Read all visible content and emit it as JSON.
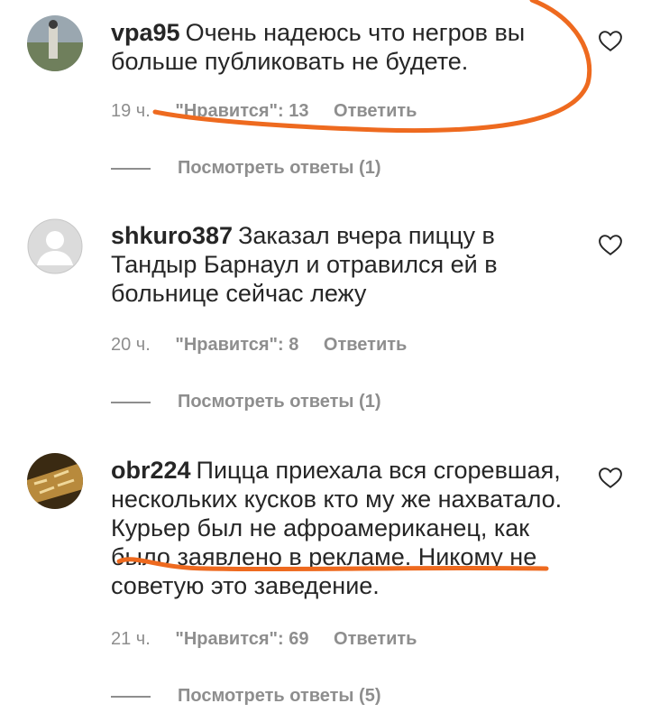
{
  "comments": [
    {
      "username": "vpa95",
      "text": "Очень надеюсь что негров вы больше публиковать не будете.",
      "time": "19 ч.",
      "likes": "\"Нравится\": 13",
      "reply": "Ответить",
      "view_replies": "Посмотреть ответы (1)"
    },
    {
      "username": "shkuro387",
      "text": "Заказал вчера пиццу в Тандыр Барнаул и отравился ей в больнице сейчас лежу",
      "time": "20 ч.",
      "likes": "\"Нравится\": 8",
      "reply": "Ответить",
      "view_replies": "Посмотреть ответы (1)"
    },
    {
      "username": "obr224",
      "text": "Пицца приехала вся сгоревшая, нескольких кусков кто му же нахватало. Курьер был не афроамериканец, как было заявлено в рекламе. Никому не советую это заведение.",
      "time": "21 ч.",
      "likes": "\"Нравится\": 69",
      "reply": "Ответить",
      "view_replies": "Посмотреть ответы (5)"
    }
  ],
  "icons": {
    "like": "heart-outline-icon",
    "default_avatar": "user-silhouette-icon"
  },
  "colors": {
    "text": "#262626",
    "secondary": "#8e8e8e",
    "annotation": "#ee6a1f"
  }
}
